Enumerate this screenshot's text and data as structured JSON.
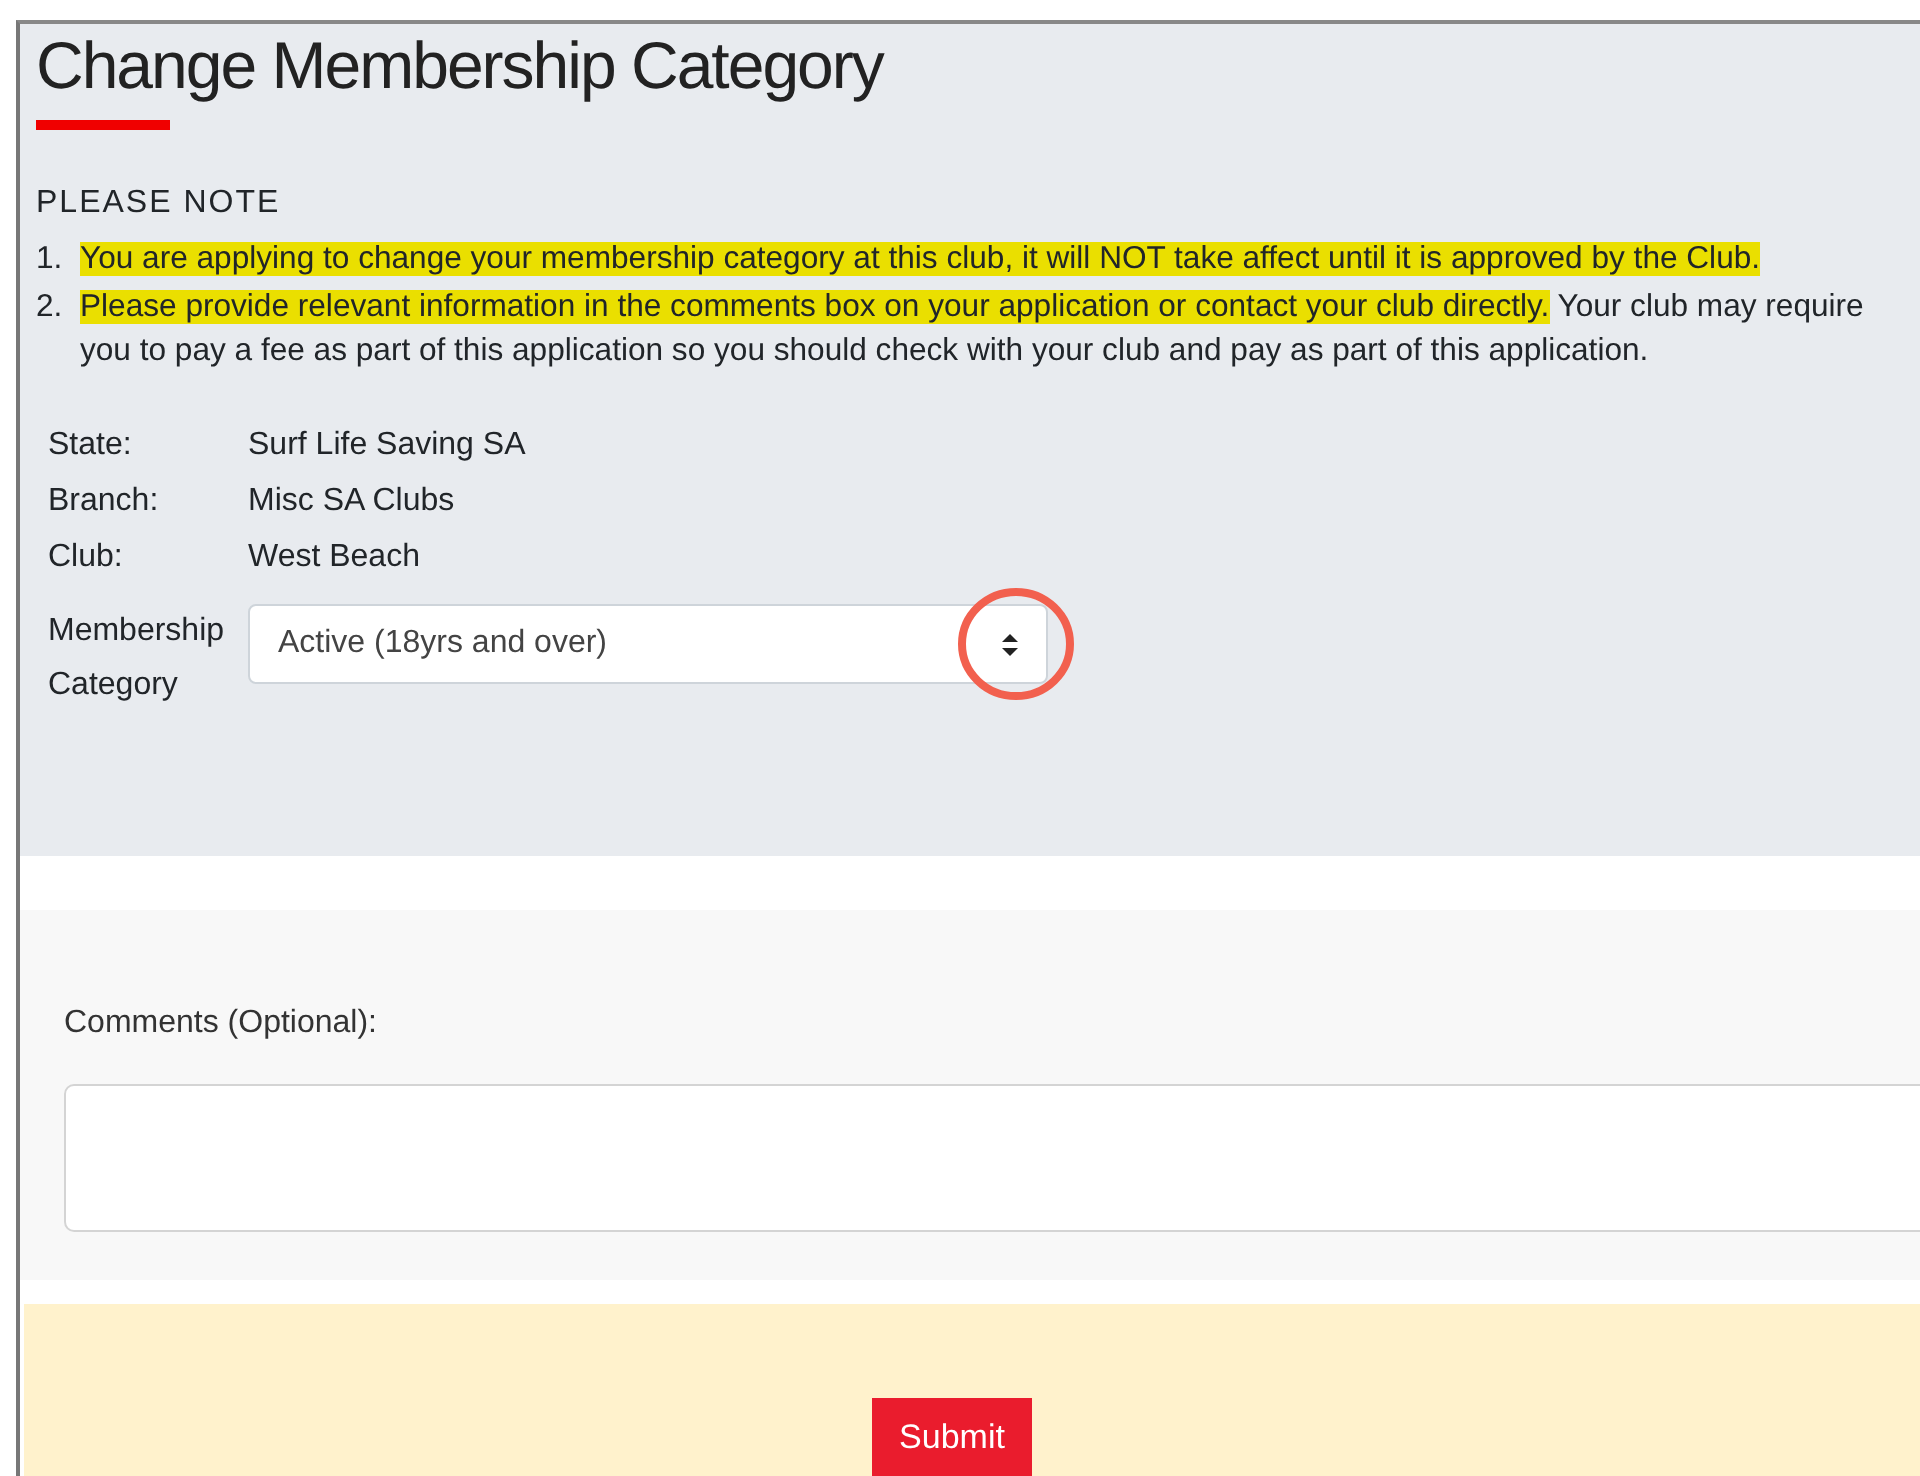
{
  "title": "Change Membership Category",
  "note_heading": "PLEASE NOTE",
  "notes": [
    {
      "number": "1.",
      "highlight": "You are applying to change your membership category at this club, it will NOT take affect until it is approved by the Club."
    },
    {
      "number": "2.",
      "highlight": "Please provide relevant information in the comments box on your application or contact your club directly.",
      "rest": "Your club may require you to pay a fee as part of this application so you should check with your club and pay as part of this application."
    }
  ],
  "details": [
    {
      "label": "State:",
      "value": "Surf Life Saving SA"
    },
    {
      "label": "Branch:",
      "value": "Misc SA Clubs"
    },
    {
      "label": "Club:",
      "value": "West Beach"
    }
  ],
  "category": {
    "label": "Membership Category",
    "value": "Active (18yrs and over)",
    "circled": true
  },
  "comments": {
    "label": "Comments (Optional):"
  },
  "submit": "Submit"
}
